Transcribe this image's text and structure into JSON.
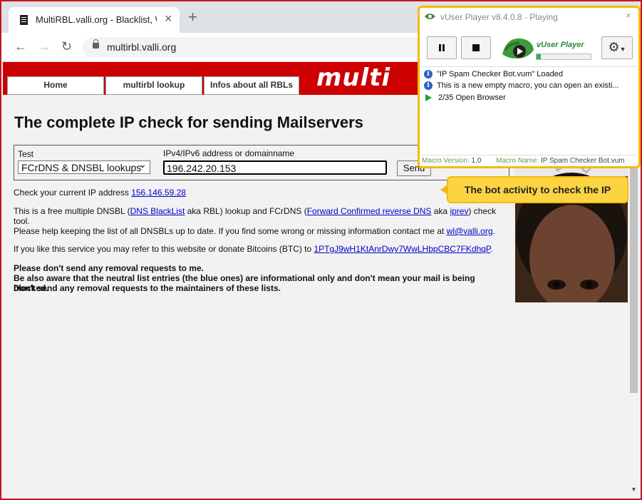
{
  "browser": {
    "tab_title": "MultiRBL.valli.org - Blacklist, Whi",
    "tab_close": "×",
    "new_tab": "+",
    "back": "←",
    "forward": "→",
    "reload": "↻",
    "url": "multirbl.valli.org"
  },
  "site": {
    "logo": "multi",
    "nav": [
      "Home",
      "multirbl lookup",
      "Infos about all RBLs"
    ],
    "heading": "The complete IP check for sending Mailservers",
    "form": {
      "test_label": "Test",
      "test_value": "FCrDNS & DNSBL lookups",
      "ip_label": "IPv4/IPv6 address or domainname",
      "ip_value": "196.242.20.153",
      "send_label": "Send"
    },
    "current_ip_text": "Check your current IP address",
    "current_ip": "156.146.59.28",
    "p1": {
      "a": "This is a free multiple DNSBL (",
      "link1": "DNS BlackList",
      "b": " aka RBL) lookup and FCrDNS (",
      "link2": "Forward Confirmed reverse DNS",
      "c": " aka ",
      "link3": "iprev",
      "d": ") check tool."
    },
    "p2": {
      "a": "Please help keeping the list of all DNSBLs up to date. If you find some wrong or missing information contact me at ",
      "email": "wl@valli.org",
      "b": "."
    },
    "p3": {
      "a": "If you like this service you may refer to this website or donate Bitcoins (BTC) to ",
      "btc": "1PTgJ9wH1KtAnrDwy7WwLHbpCBC7FKdhqP",
      "b": "."
    },
    "warn1": "Please don't send any removal requests to me.",
    "warn2": "Be also aware that the neutral list entries (the blue ones) are informational only and don't mean your mail is being blocked.",
    "warn3": "Don't send any removal requests to the maintainers of these lists."
  },
  "vuser": {
    "title": "vUser Player v8.4.0.8 - Playing",
    "close": "×",
    "brand": "vUser Player",
    "progress": 0.08,
    "log": [
      {
        "icon": "info-icon",
        "text": "\"IP Spam Checker Bot.vum\" Loaded"
      },
      {
        "icon": "info-icon",
        "text": "This is a new empty macro, you can open an existi..."
      },
      {
        "icon": "play-icon",
        "text": "2/35 Open Browser"
      }
    ],
    "macro_version_label": "Macro Version:",
    "macro_version": "1.0",
    "macro_name_label": "Macro Name:",
    "macro_name": "IP Spam Checker Bot.vum"
  },
  "callout": "The bot activity to check the IP",
  "colors": {
    "frame": "#c4161c",
    "site_red": "#cc0000",
    "overlay_border": "#f5b90c",
    "callout_bg": "#fcd443"
  }
}
